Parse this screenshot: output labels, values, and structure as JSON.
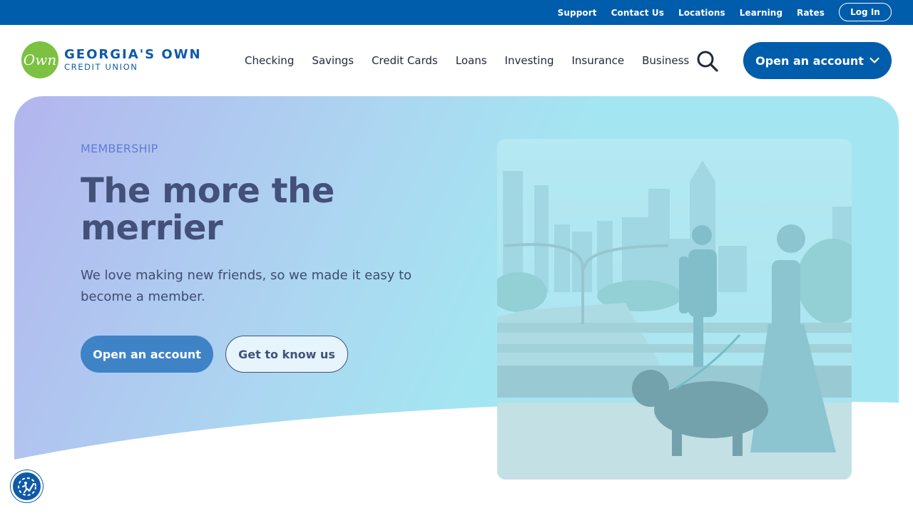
{
  "utility_nav": {
    "links": [
      "Support",
      "Contact Us",
      "Locations",
      "Learning",
      "Rates"
    ],
    "login_label": "Log In"
  },
  "logo": {
    "badge_text": "Own",
    "line1": "GEORGIA'S OWN",
    "line2": "CREDIT UNION"
  },
  "main_nav": {
    "items": [
      "Checking",
      "Savings",
      "Credit Cards",
      "Loans",
      "Investing",
      "Insurance",
      "Business"
    ],
    "open_account_label": "Open an account"
  },
  "hero": {
    "eyebrow": "MEMBERSHIP",
    "title": "The more the merrier",
    "subtitle": "We love making new friends, so we made it easy to become a member.",
    "primary_cta": "Open an account",
    "secondary_cta": "Get to know us"
  },
  "icons": {
    "search": "search-icon",
    "chevron": "chevron-down-icon",
    "accessibility": "accessibility-icon"
  },
  "colors": {
    "brand_blue": "#005dab",
    "logo_green": "#7cc142",
    "hero_text": "#43507a"
  }
}
